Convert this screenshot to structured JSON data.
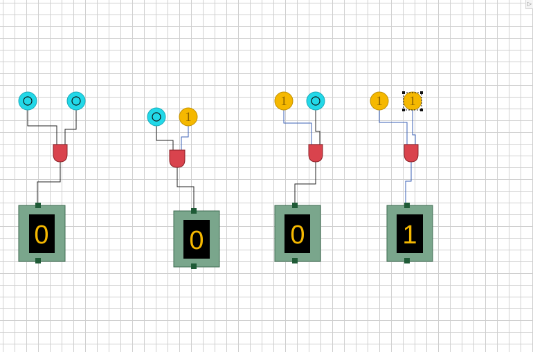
{
  "toolbar": {
    "collapse_glyph": "▷"
  },
  "circuits": [
    {
      "inputs": [
        {
          "state": "off",
          "value": ""
        },
        {
          "state": "off",
          "value": ""
        }
      ],
      "gate": "AND",
      "output": {
        "value": "0"
      }
    },
    {
      "inputs": [
        {
          "state": "off",
          "value": ""
        },
        {
          "state": "on",
          "value": "1"
        }
      ],
      "gate": "AND",
      "output": {
        "value": "0"
      }
    },
    {
      "inputs": [
        {
          "state": "on",
          "value": "1"
        },
        {
          "state": "off",
          "value": ""
        }
      ],
      "gate": "AND",
      "output": {
        "value": "0"
      }
    },
    {
      "inputs": [
        {
          "state": "on",
          "value": "1"
        },
        {
          "state": "on",
          "value": "1",
          "selected": true
        }
      ],
      "gate": "AND",
      "output": {
        "value": "1"
      }
    }
  ],
  "colors": {
    "switch_off": "#22d8e8",
    "switch_on": "#f5b800",
    "gate": "#d9434d",
    "display_case": "#7aa68c",
    "display_screen": "#000000",
    "digit": "#f5b800",
    "wire_low": "#222222",
    "wire_high": "#3a5fb5"
  }
}
